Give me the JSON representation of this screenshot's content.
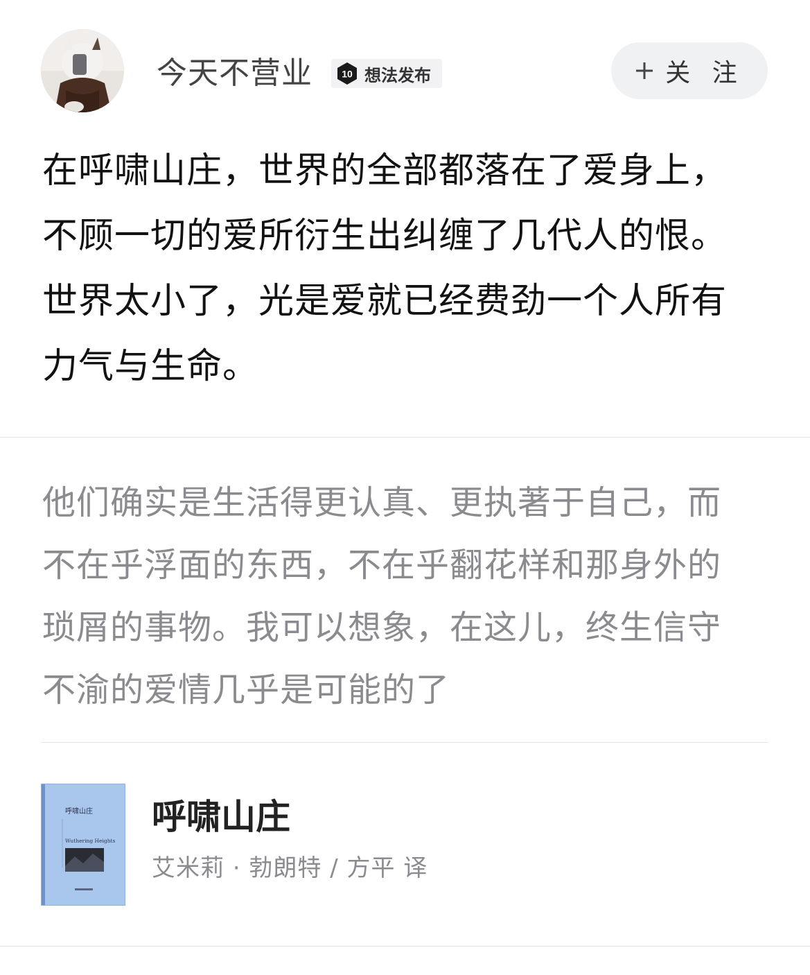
{
  "author": {
    "name": "今天不营业",
    "badge_level": "10",
    "badge_label": "想法发布"
  },
  "follow_button": {
    "label": "关 注"
  },
  "post": {
    "lines": [
      "在呼啸山庄，世界的全部都落在了爱身上，",
      "不顾一切的爱所衍生出纠缠了几代人的恨。",
      "世界太小了，光是爱就已经费劲一个人所有",
      "力气与生命。"
    ]
  },
  "quote": {
    "lines": [
      "他们确实是生活得更认真、更执著于自己，而",
      "不在乎浮面的东西，不在乎翻花样和那身外的",
      "琐屑的事物。我可以想象，在这儿，终生信守",
      "不渝的爱情几乎是可能的了"
    ]
  },
  "book": {
    "title": "呼啸山庄",
    "author_line": "艾米莉 · 勃朗特 / 方平 译",
    "cover_title": "呼啸山庄",
    "cover_subtitle": "Wuthering Heights"
  }
}
